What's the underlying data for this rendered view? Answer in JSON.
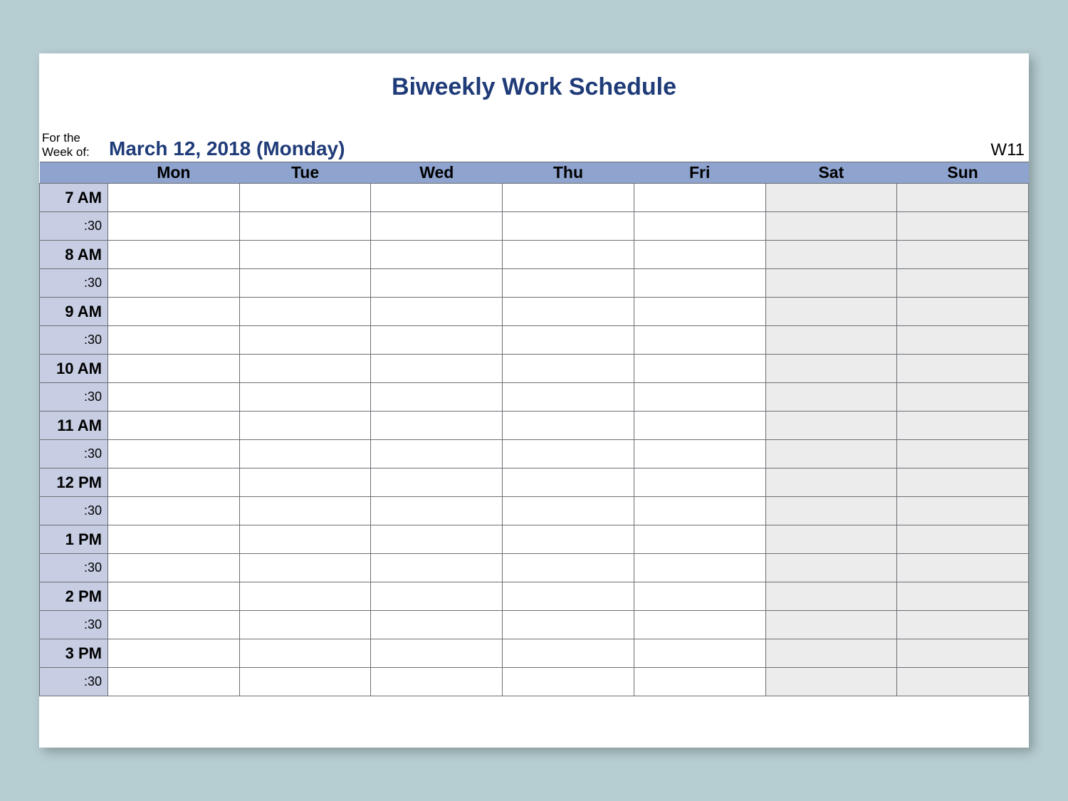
{
  "title": "Biweekly Work Schedule",
  "meta": {
    "label_line1": "For the",
    "label_line2": "Week of:",
    "date": "March 12, 2018 (Monday)",
    "week_number": "W11"
  },
  "days": [
    "Mon",
    "Tue",
    "Wed",
    "Thu",
    "Fri",
    "Sat",
    "Sun"
  ],
  "weekend_indices": [
    5,
    6
  ],
  "times": [
    {
      "hour": "7 AM",
      "half": ":30"
    },
    {
      "hour": "8 AM",
      "half": ":30"
    },
    {
      "hour": "9 AM",
      "half": ":30"
    },
    {
      "hour": "10 AM",
      "half": ":30"
    },
    {
      "hour": "11 AM",
      "half": ":30"
    },
    {
      "hour": "12 PM",
      "half": ":30"
    },
    {
      "hour": "1 PM",
      "half": ":30"
    },
    {
      "hour": "2 PM",
      "half": ":30"
    },
    {
      "hour": "3 PM",
      "half": ":30"
    }
  ]
}
